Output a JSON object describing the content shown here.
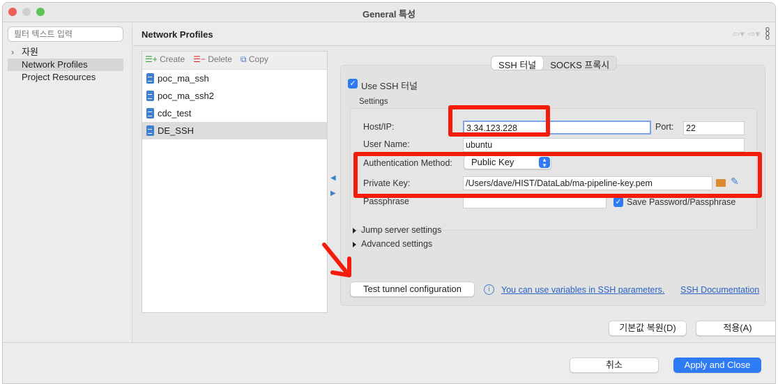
{
  "window": {
    "title": "General 특성"
  },
  "sidebar": {
    "filter_placeholder": "필터 텍스트 입력",
    "items": [
      {
        "label": "자원"
      },
      {
        "label": "Network Profiles"
      },
      {
        "label": "Project Resources"
      }
    ]
  },
  "main": {
    "title": "Network Profiles"
  },
  "profiles": {
    "toolbar": {
      "create": "Create",
      "delete": "Delete",
      "copy": "Copy"
    },
    "items": [
      "poc_ma_ssh",
      "poc_ma_ssh2",
      "cdc_test",
      "DE_SSH"
    ]
  },
  "tabs": [
    "SSH 터널",
    "SOCKS 프록시"
  ],
  "ssh": {
    "use_ssh_label": "Use SSH 터널",
    "settings_label": "Settings",
    "host_label": "Host/IP:",
    "host_value": "3.34.123.228",
    "port_label": "Port:",
    "port_value": "22",
    "user_label": "User Name:",
    "user_value": "ubuntu",
    "auth_label": "Authentication Method:",
    "auth_value": "Public Key",
    "key_label": "Private Key:",
    "key_value": "/Users/dave/HIST/DataLab/ma-pipeline-key.pem",
    "pass_label": "Passphrase",
    "pass_value": "",
    "save_pass_label": "Save Password/Passphrase",
    "jump_label": "Jump server settings",
    "advanced_label": "Advanced settings",
    "test_button": "Test tunnel configuration",
    "variables_link": "You can use variables in SSH parameters.",
    "docs_link": "SSH Documentation"
  },
  "buttons": {
    "restore": "기본값 복원(D)",
    "apply": "적용(A)",
    "cancel": "취소",
    "apply_close": "Apply and Close"
  },
  "colors": {
    "accent": "#2f7bf5",
    "annotation": "#f51c0c"
  }
}
